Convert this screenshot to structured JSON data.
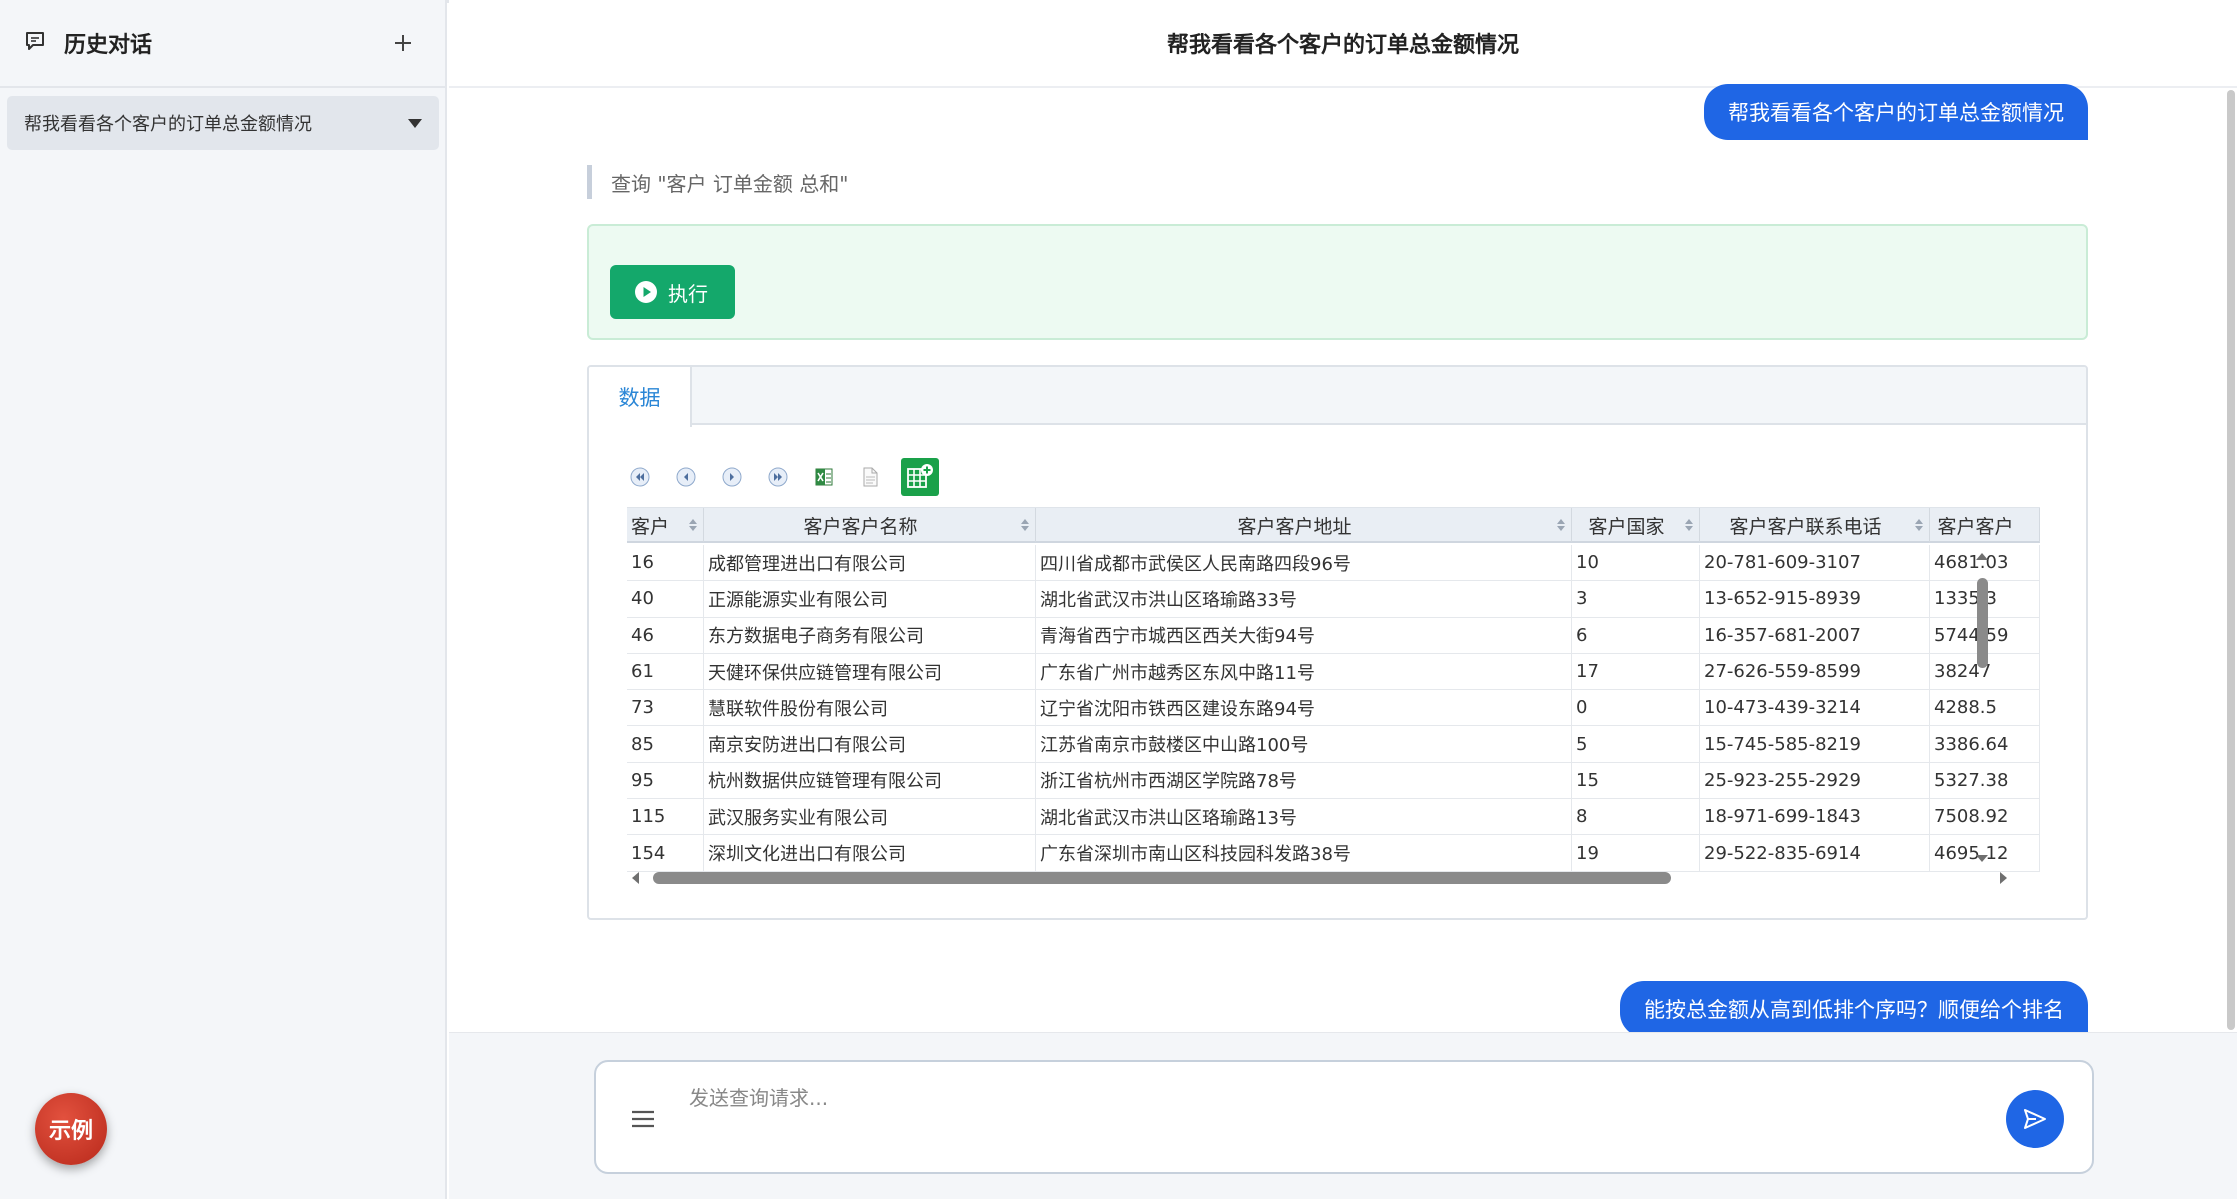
{
  "sidebar": {
    "title": "历史对话",
    "history": [
      {
        "label": "帮我看看各个客户的订单总金额情况"
      }
    ],
    "examples_label": "示例"
  },
  "header": {
    "title": "帮我看看各个客户的订单总金额情况"
  },
  "messages": {
    "user1": "帮我看看各个客户的订单总金额情况",
    "query": "查询 \"客户 订单金额 总和\"",
    "execute_label": "执行",
    "user2": "能按总金额从高到低排个序吗？顺便给个排名"
  },
  "data_panel": {
    "tab_label": "数据",
    "columns": [
      "客户",
      "客户客户名称",
      "客户客户地址",
      "客户国家",
      "客户客户联系电话",
      "客户客户"
    ],
    "rows": [
      [
        "16",
        "成都管理进出口有限公司",
        "四川省成都市武侯区人民南路四段96号",
        "10",
        "20-781-609-3107",
        "4681.03"
      ],
      [
        "40",
        "正源能源实业有限公司",
        "湖北省武汉市洪山区珞瑜路33号",
        "3",
        "13-652-915-8939",
        "1335.3"
      ],
      [
        "46",
        "东方数据电子商务有限公司",
        "青海省西宁市城西区西关大街94号",
        "6",
        "16-357-681-2007",
        "5744.59"
      ],
      [
        "61",
        "天健环保供应链管理有限公司",
        "广东省广州市越秀区东风中路11号",
        "17",
        "27-626-559-8599",
        "38247"
      ],
      [
        "73",
        "慧联软件股份有限公司",
        "辽宁省沈阳市铁西区建设东路94号",
        "0",
        "10-473-439-3214",
        "4288.5"
      ],
      [
        "85",
        "南京安防进出口有限公司",
        "江苏省南京市鼓楼区中山路100号",
        "5",
        "15-745-585-8219",
        "3386.64"
      ],
      [
        "95",
        "杭州数据供应链管理有限公司",
        "浙江省杭州市西湖区学院路78号",
        "15",
        "25-923-255-2929",
        "5327.38"
      ],
      [
        "115",
        "武汉服务实业有限公司",
        "湖北省武汉市洪山区珞瑜路13号",
        "8",
        "18-971-699-1843",
        "7508.92"
      ],
      [
        "154",
        "深圳文化进出口有限公司",
        "广东省深圳市南山区科技园科发路38号",
        "19",
        "29-522-835-6914",
        "4695.12"
      ]
    ]
  },
  "composer": {
    "placeholder": "发送查询请求..."
  },
  "icons": {
    "chat": "chat-bubble-icon",
    "add": "plus-icon",
    "caret": "caret-down-icon",
    "play": "play-circle-icon",
    "menu": "menu-icon",
    "send": "send-icon"
  },
  "colors": {
    "accent": "#1f66e5",
    "execute": "#14a86b",
    "examples": "#c63a2a",
    "tab": "#2a86d6"
  }
}
